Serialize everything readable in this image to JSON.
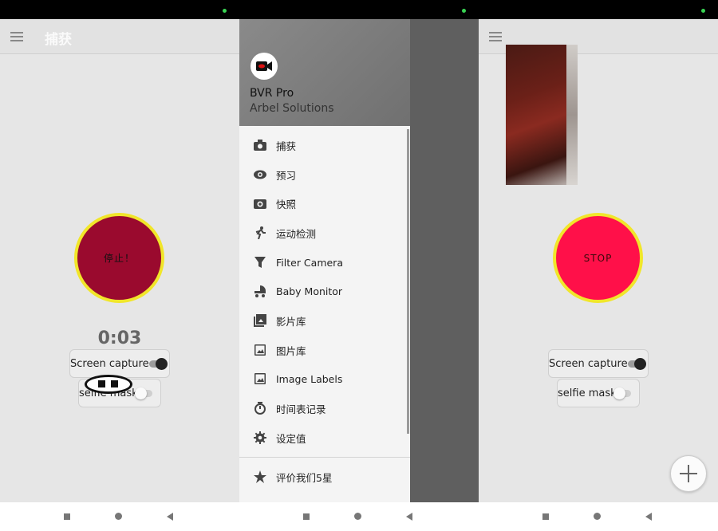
{
  "screen1": {
    "title": "捕获",
    "record_button_label": "停止！",
    "timer": "0:03",
    "screen_capture_label": "Screen capture",
    "selfie_mask_label": "selfie mask"
  },
  "drawer": {
    "app_name": "BVR Pro",
    "vendor": "Arbel Solutions",
    "items": [
      {
        "label": "捕获",
        "icon": "camera-icon"
      },
      {
        "label": "预习",
        "icon": "eye-icon"
      },
      {
        "label": "快照",
        "icon": "snapshot-icon"
      },
      {
        "label": "运动检测",
        "icon": "running-icon"
      },
      {
        "label": "Filter Camera",
        "icon": "filter-icon"
      },
      {
        "label": "Baby Monitor",
        "icon": "stroller-icon"
      },
      {
        "label": "影片库",
        "icon": "video-library-icon"
      },
      {
        "label": "图片库",
        "icon": "image-icon"
      },
      {
        "label": "Image Labels",
        "icon": "image-label-icon"
      },
      {
        "label": "时间表记录",
        "icon": "timer-icon"
      },
      {
        "label": "设定值",
        "icon": "gear-icon"
      }
    ],
    "secondary_items": [
      {
        "label": "评价我们5星",
        "icon": "star-icon"
      }
    ]
  },
  "screen3": {
    "record_button_label": "STOP",
    "screen_capture_label": "Screen capture",
    "selfie_mask_label": "selfie mask"
  },
  "colors": {
    "record_dark": "#9a0a2e",
    "record_bright": "#ff1049",
    "ring": "#f1e62a",
    "status_dot": "#39d353"
  }
}
